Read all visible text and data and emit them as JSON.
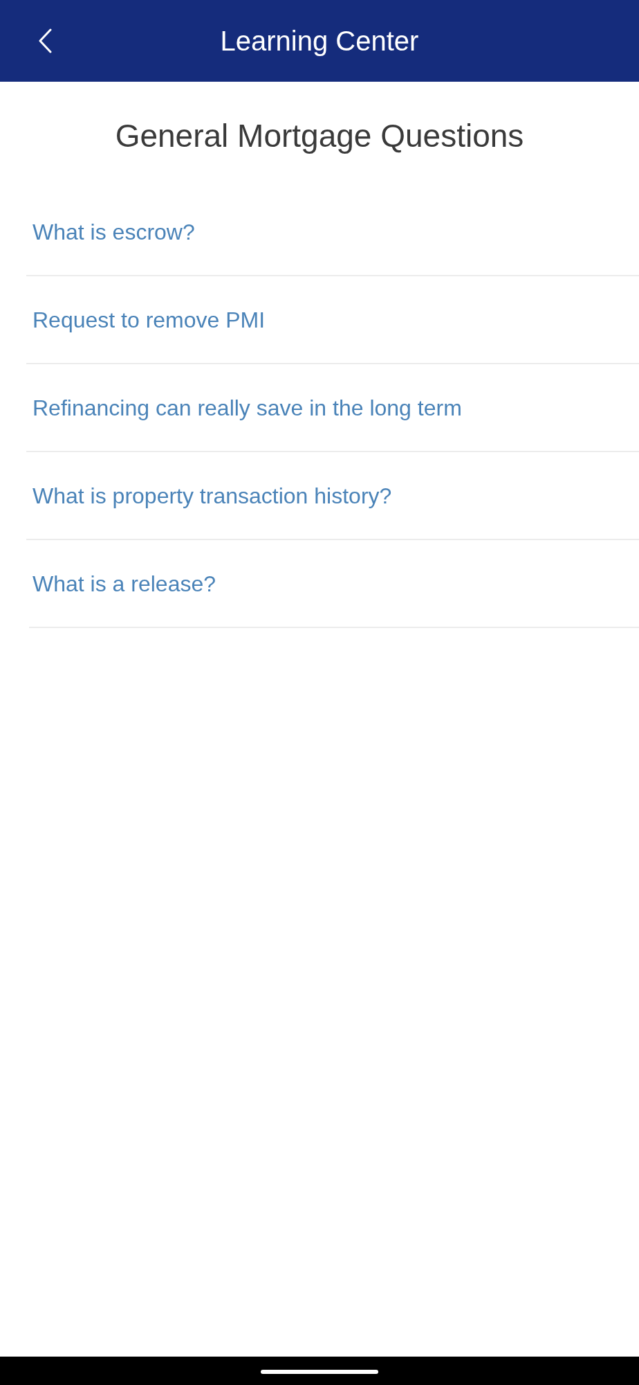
{
  "header": {
    "title": "Learning Center"
  },
  "section_title": "General Mortgage Questions",
  "questions": [
    {
      "label": "What is escrow?"
    },
    {
      "label": "Request to remove PMI"
    },
    {
      "label": "Refinancing can really save in the long term"
    },
    {
      "label": "What is property transaction history?"
    },
    {
      "label": "What is a release?"
    }
  ]
}
